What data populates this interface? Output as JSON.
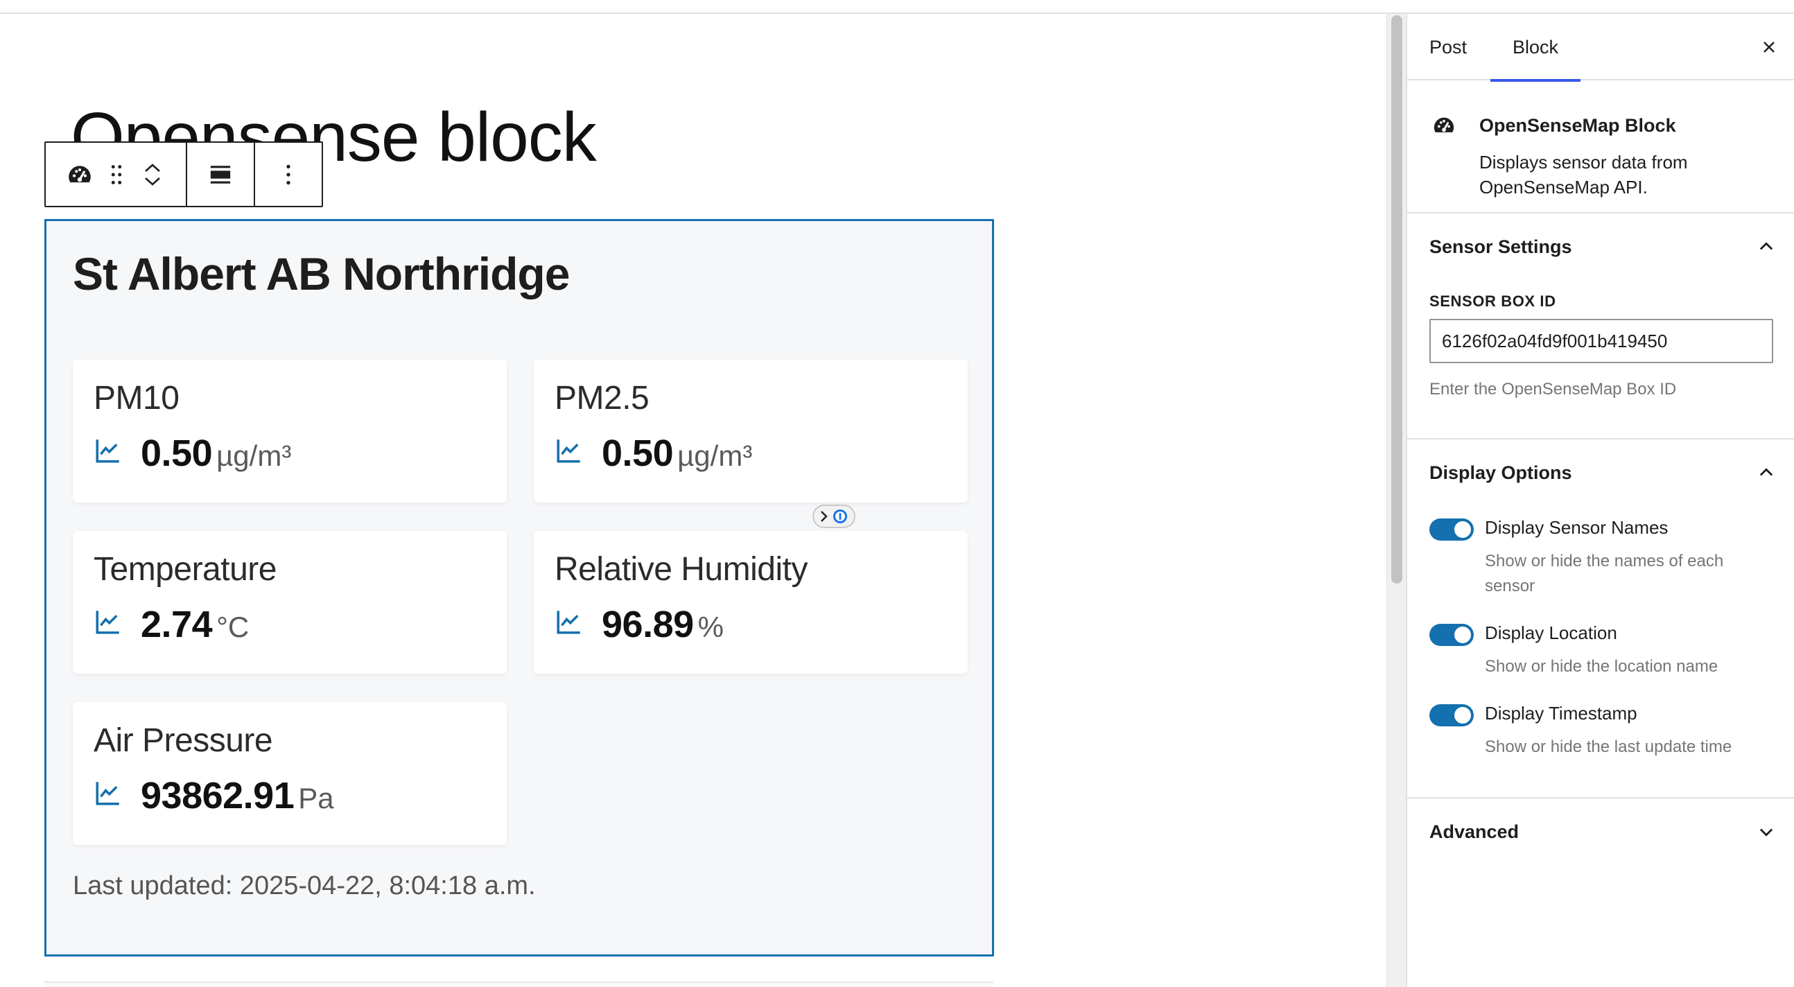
{
  "editor": {
    "post_title": "Opensense block",
    "block": {
      "location_name": "St Albert AB Northridge",
      "sensors": [
        {
          "name": "PM10",
          "value": "0.50",
          "unit": "µg/m³"
        },
        {
          "name": "PM2.5",
          "value": "0.50",
          "unit": "µg/m³"
        },
        {
          "name": "Temperature",
          "value": "2.74",
          "unit": "°C"
        },
        {
          "name": "Relative Humidity",
          "value": "96.89",
          "unit": "%"
        },
        {
          "name": "Air Pressure",
          "value": "93862.91",
          "unit": "Pa"
        }
      ],
      "last_updated": "Last updated: 2025-04-22, 8:04:18 a.m."
    },
    "toolbar": {
      "icons": [
        "gauge-icon",
        "drag-handle-icon",
        "chevron-up-icon",
        "chevron-down-icon",
        "align-full-icon",
        "more-vertical-icon"
      ]
    }
  },
  "sidebar": {
    "tabs": [
      "Post",
      "Block"
    ],
    "active_tab": "Block",
    "block_card": {
      "title": "OpenSenseMap Block",
      "description": "Displays sensor data from OpenSenseMap API."
    },
    "sensor_settings": {
      "title": "Sensor Settings",
      "box_id_label": "SENSOR BOX ID",
      "box_id_value": "6126f02a04fd9f001b419450",
      "box_id_help": "Enter the OpenSenseMap Box ID"
    },
    "display_options": {
      "title": "Display Options",
      "toggles": [
        {
          "label": "Display Sensor Names",
          "help": "Show or hide the names of each sensor",
          "checked": true
        },
        {
          "label": "Display Location",
          "help": "Show or hide the location name",
          "checked": true
        },
        {
          "label": "Display Timestamp",
          "help": "Show or hide the last update time",
          "checked": true
        }
      ]
    },
    "advanced": {
      "title": "Advanced"
    }
  },
  "colors": {
    "accent": "#1470ae",
    "tab_indicator": "#3858e9",
    "block_background": "#f6f7f9"
  }
}
